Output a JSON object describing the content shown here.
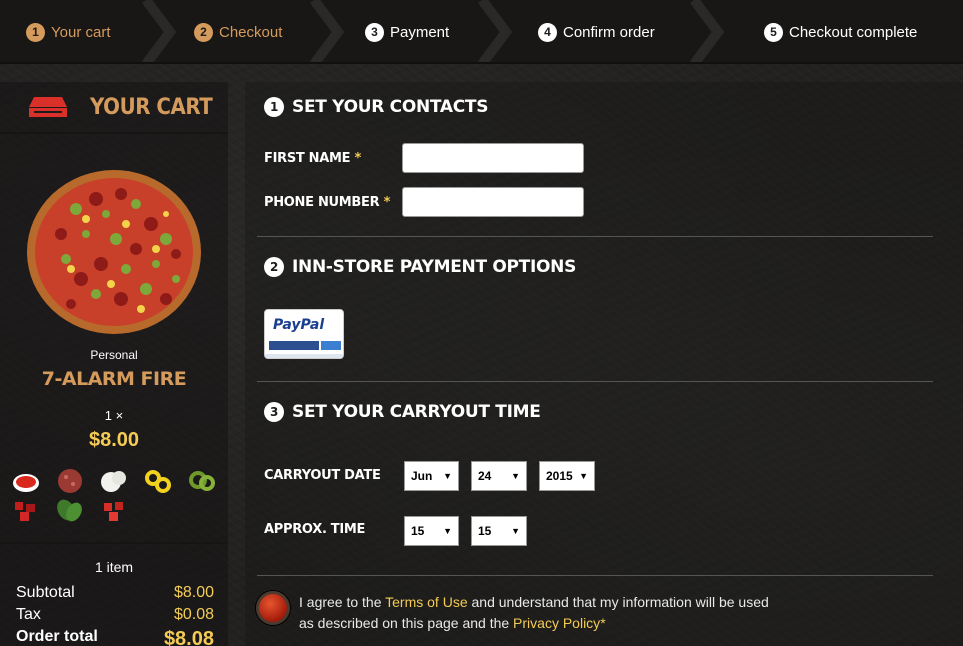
{
  "steps": [
    {
      "num": "1",
      "label": "Your cart",
      "state": "done"
    },
    {
      "num": "2",
      "label": "Checkout",
      "state": "done"
    },
    {
      "num": "3",
      "label": "Payment",
      "state": "todo"
    },
    {
      "num": "4",
      "label": "Confirm order",
      "state": "todo"
    },
    {
      "num": "5",
      "label": "Checkout complete",
      "state": "todo"
    }
  ],
  "cart": {
    "title": "YOUR CART",
    "icon": "pizza-box-icon",
    "item": {
      "size": "Personal",
      "name": "7-ALARM FIRE",
      "qty": "1 ×",
      "price": "$8.00",
      "toppings": [
        "tomato-sauce",
        "pepperoni",
        "mozzarella",
        "banana-peppers",
        "jalapenos",
        "red-peppers",
        "spinach",
        "tomatoes"
      ]
    },
    "count": "1 item",
    "subtotal_label": "Subtotal",
    "subtotal": "$8.00",
    "tax_label": "Tax",
    "tax": "$0.08",
    "total_label": "Order total",
    "total": "$8.08"
  },
  "contacts": {
    "num": "1",
    "title": "SET YOUR CONTACTS",
    "first_name_label": "FIRST NAME",
    "phone_label": "PHONE NUMBER",
    "required_mark": "*",
    "first_name_value": "",
    "phone_value": ""
  },
  "payment": {
    "num": "2",
    "title": "INN-STORE PAYMENT OPTIONS",
    "paypal_label": "PayPal"
  },
  "carryout": {
    "num": "3",
    "title": "SET YOUR CARRYOUT TIME",
    "date_label": "CARRYOUT DATE",
    "month": "Jun",
    "day": "24",
    "year": "2015",
    "time_label": "APPROX. TIME",
    "hour": "15",
    "minute": "15"
  },
  "agreement": {
    "text1": "I agree to the ",
    "terms": "Terms of Use",
    "text2": " and understand that my information will be used as described on this page and the ",
    "privacy": "Privacy Policy",
    "required_mark": "*"
  },
  "colors": {
    "accent": "#d59b5d",
    "price": "#f3cb55",
    "background": "#222120"
  }
}
